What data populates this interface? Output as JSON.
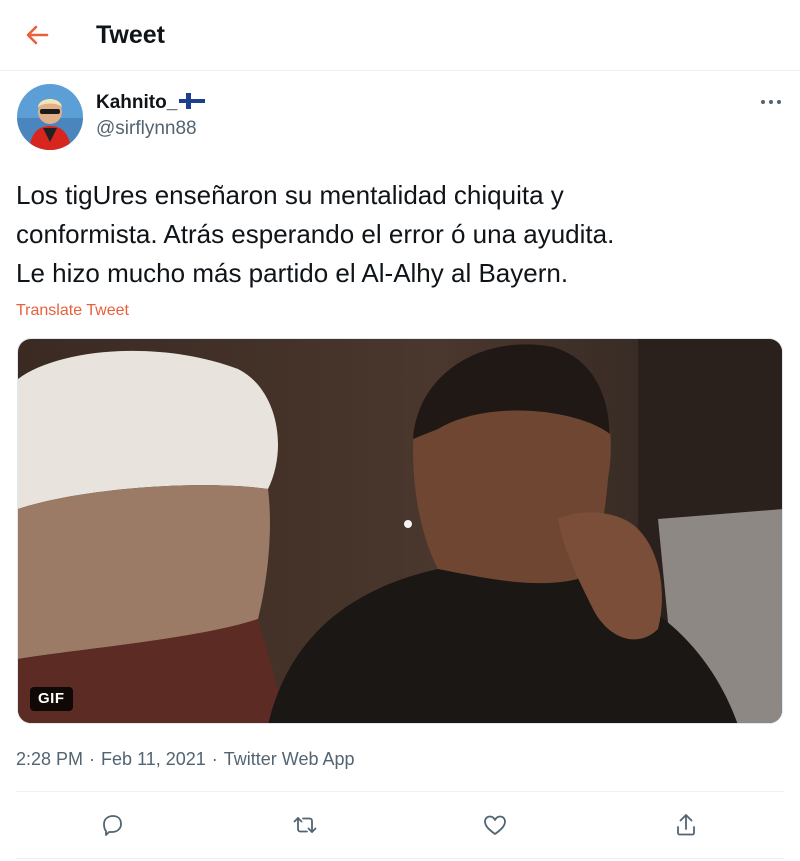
{
  "header": {
    "title": "Tweet",
    "back_icon": "arrow-left-icon",
    "accent": "#e8603c"
  },
  "tweet": {
    "author": {
      "name": "Kahnito_",
      "flag": "finland-flag-icon",
      "handle": "@sirflynn88"
    },
    "text_lines": [
      "Los tigUres enseñaron su mentalidad chiquita y",
      "conformista. Atrás esperando el error ó una ayudita.",
      "Le hizo mucho más partido el Al-Alhy al Bayern."
    ],
    "translate": "Translate Tweet",
    "media": {
      "badge": "GIF"
    },
    "time": "2:28 PM",
    "date": "Feb 11, 2021",
    "source": "Twitter Web App",
    "separator": "·",
    "actions": [
      "reply-icon",
      "retweet-icon",
      "like-icon",
      "share-icon"
    ]
  }
}
